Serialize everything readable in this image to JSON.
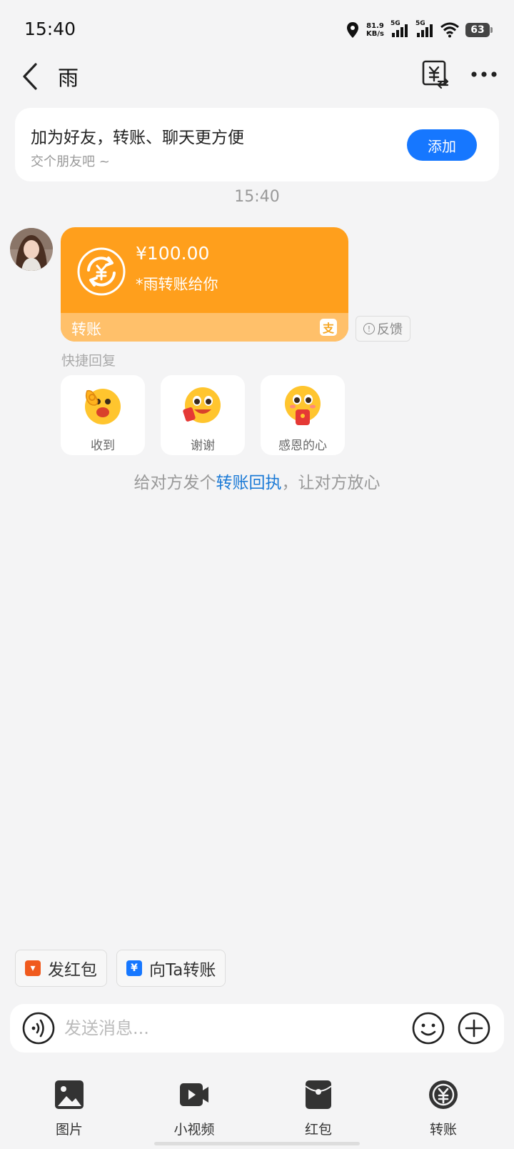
{
  "status_bar": {
    "time": "15:40",
    "net_speed_value": "81.9",
    "net_speed_unit": "KB/s",
    "signal1_label": "5G",
    "signal2_label": "5G",
    "battery_level": "63"
  },
  "header": {
    "title": "雨"
  },
  "friend_banner": {
    "title": "加为好友，转账、聊天更方便",
    "subtitle": "交个朋友吧 ~",
    "add_label": "添加"
  },
  "chat": {
    "timestamp": "15:40",
    "transfer": {
      "amount": "¥100.00",
      "description": "*雨转账给你",
      "footer_label": "转账"
    },
    "feedback_label": "反馈",
    "quick_reply_label": "快捷回复",
    "quick_replies": [
      {
        "label": "收到"
      },
      {
        "label": "谢谢"
      },
      {
        "label": "感恩的心"
      }
    ],
    "receipt_hint": {
      "before": "给对方发个",
      "link": "转账回执",
      "after": "，让对方放心"
    }
  },
  "actions": {
    "red_packet_label": "发红包",
    "transfer_label": "向Ta转账"
  },
  "input": {
    "placeholder": "发送消息..."
  },
  "toolbar": {
    "items": [
      {
        "label": "图片"
      },
      {
        "label": "小视频"
      },
      {
        "label": "红包"
      },
      {
        "label": "转账"
      }
    ]
  },
  "colors": {
    "accent_blue": "#1677ff",
    "transfer_orange": "#ff9f1c",
    "transfer_footer": "#ffc06a",
    "link_blue": "#1b7ad6"
  }
}
